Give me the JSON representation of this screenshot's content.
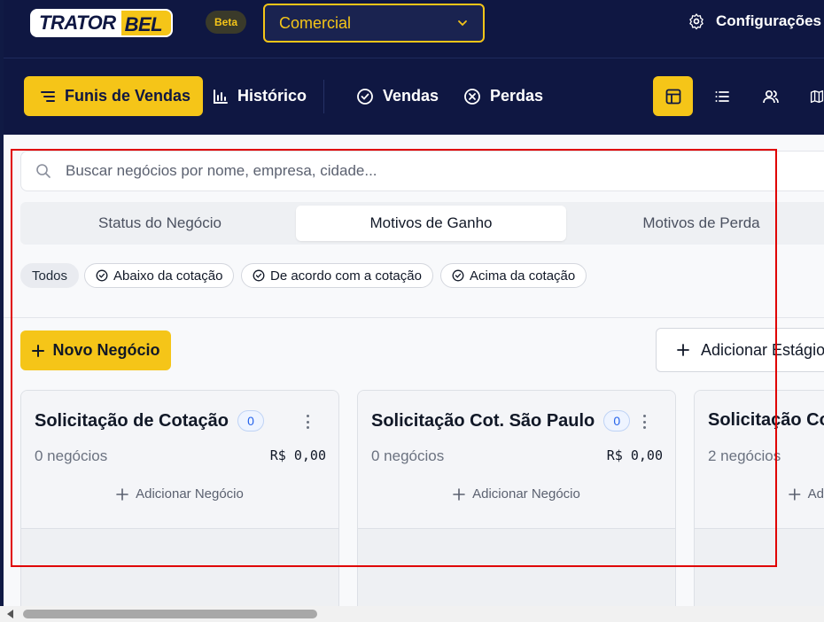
{
  "header": {
    "logo_text": "TRATORBEL",
    "logo_part1": "TRATOR",
    "logo_part2": "BEL",
    "beta_label": "Beta",
    "department": "Comercial",
    "settings_label": "Configurações",
    "nav": [
      {
        "label": "Funis de Vendas",
        "icon": "menu-lines-icon",
        "active": true
      },
      {
        "label": "Histórico",
        "icon": "bar-chart-icon",
        "active": false
      },
      {
        "label": "Vendas",
        "icon": "check-circle-icon",
        "active": false
      },
      {
        "label": "Perdas",
        "icon": "x-circle-icon",
        "active": false
      }
    ],
    "views": [
      "kanban-icon",
      "list-icon",
      "users-icon",
      "map-icon"
    ]
  },
  "search": {
    "placeholder": "Buscar negócios por nome, empresa, cidade..."
  },
  "tabs": [
    {
      "label": "Status do Negócio",
      "active": false
    },
    {
      "label": "Motivos de Ganho",
      "active": true
    },
    {
      "label": "Motivos de Perda",
      "active": false
    }
  ],
  "filters": [
    {
      "label": "Todos",
      "active": true
    },
    {
      "label": "Abaixo da cotação",
      "active": false
    },
    {
      "label": "De acordo com a cotação",
      "active": false
    },
    {
      "label": "Acima da cotação",
      "active": false
    }
  ],
  "actions": {
    "new_deal": "Novo Negócio",
    "add_stage": "Adicionar Estágio"
  },
  "columns": [
    {
      "title": "Solicitação de Cotação",
      "count": "0",
      "deals": "0 negócios",
      "value": "R$ 0,00",
      "add_label": "Adicionar Negócio"
    },
    {
      "title": "Solicitação Cot. São Paulo",
      "count": "0",
      "deals": "0 negócios",
      "value": "R$ 0,00",
      "add_label": "Adicionar Negócio"
    },
    {
      "title": "Solicitação Cot",
      "count": "",
      "deals": "2 negócios",
      "value": "",
      "add_label": "Ad"
    }
  ],
  "colors": {
    "brand_navy": "#0f1742",
    "brand_yellow": "#f5c518",
    "highlight_red": "#e00000"
  }
}
